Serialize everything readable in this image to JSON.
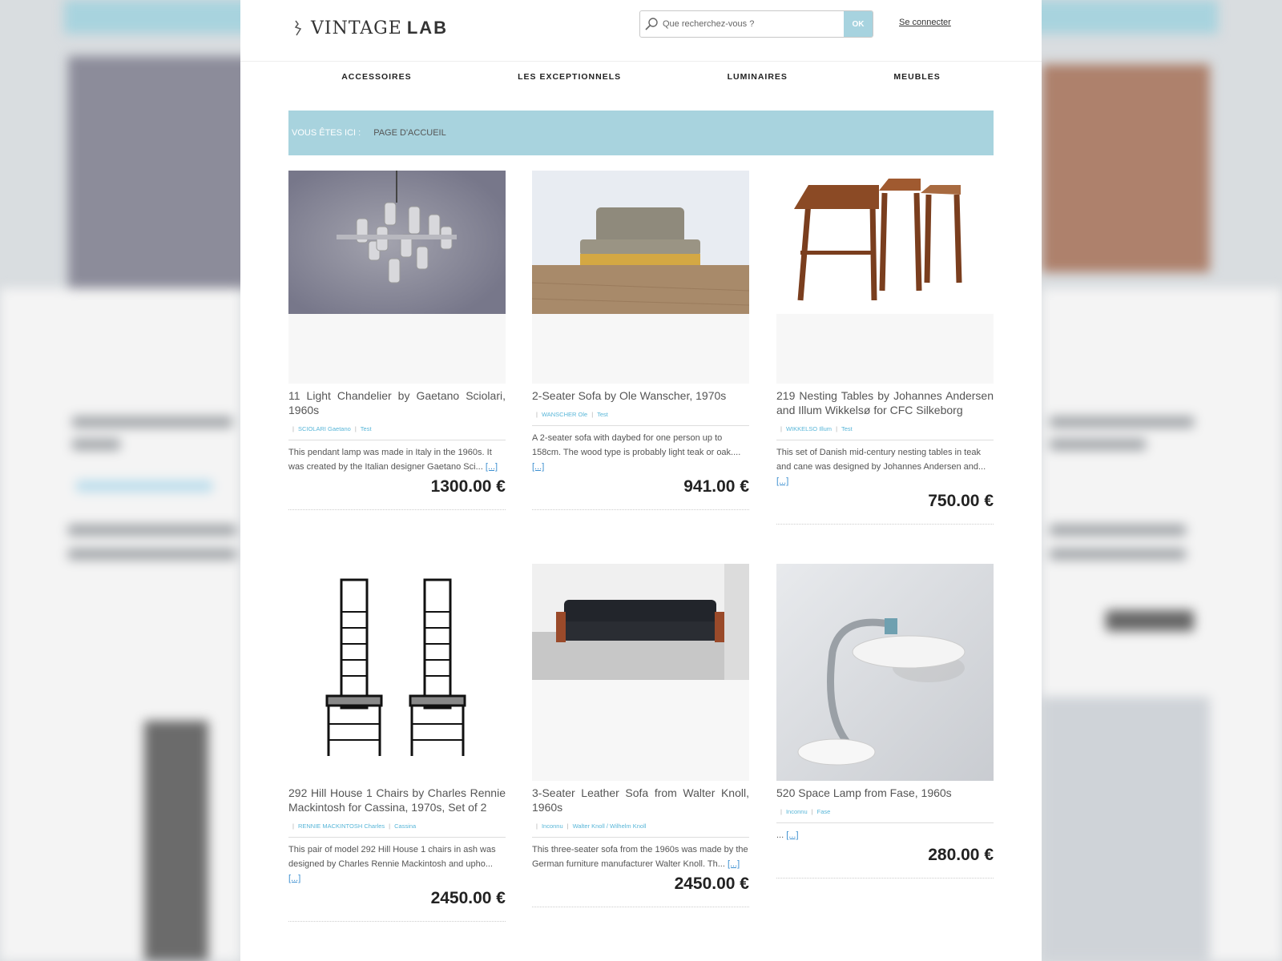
{
  "brand": {
    "name": "VINTAGE",
    "name_bold": "LAB"
  },
  "search": {
    "placeholder": "Que recherchez-vous ?",
    "button": "OK"
  },
  "account": {
    "login": "Se connecter"
  },
  "nav": [
    "ACCESSOIRES",
    "LES EXCEPTIONNELS",
    "LUMINAIRES",
    "MEUBLES"
  ],
  "breadcrumb": {
    "label": "VOUS ÊTES ICI :",
    "current": "PAGE D'ACCUEIL"
  },
  "products": [
    {
      "title": "11 Light Chandelier by Gaetano Sciolari, 1960s",
      "tags": [
        "SCIOLARI Gaetano",
        "Test"
      ],
      "description": "This pendant lamp was made in Italy in the 1960s. It was created by the Italian designer Gaetano Sci...",
      "more": "[...]",
      "price": "1300.00 €",
      "image": "chandelier"
    },
    {
      "title": "2-Seater Sofa by Ole Wanscher, 1970s",
      "tags": [
        "WANSCHER Ole",
        "Test"
      ],
      "description": "A 2-seater sofa with daybed for one person up to 158cm. The wood type is probably light teak or oak....",
      "more": "[...]",
      "price": "941.00 €",
      "image": "sofa-2-seater"
    },
    {
      "title": "219 Nesting Tables by Johannes Andersen and Illum Wikkelsø for CFC Silkeborg",
      "tags": [
        "WIKKELSO Illum",
        "Test"
      ],
      "description": "This set of Danish mid-century nesting tables in teak and cane was designed by Johannes Andersen and...",
      "more": "[...]",
      "price": "750.00 €",
      "image": "nesting-tables"
    },
    {
      "title": "292 Hill House 1 Chairs by Charles Rennie Mackintosh for Cassina, 1970s, Set of 2",
      "tags": [
        "RENNIE MACKINTOSH Charles",
        "Cassina"
      ],
      "description": "This pair of model 292 Hill House 1 chairs in ash was designed by Charles Rennie Mackintosh and upho...",
      "more": "[...]",
      "price": "2450.00 €",
      "image": "chairs"
    },
    {
      "title": "3-Seater Leather Sofa from Walter Knoll, 1960s",
      "tags": [
        "Inconnu",
        "Walter Knoll / Wilhelm Knoll"
      ],
      "description": "This three-seater sofa from the 1960s was made by the German furniture manufacturer Walter Knoll. Th...",
      "more": "[...]",
      "price": "2450.00 €",
      "image": "sofa-leather"
    },
    {
      "title": "520 Space Lamp from Fase, 1960s",
      "tags": [
        "Inconnu",
        "Fase"
      ],
      "description": "...",
      "more": "[...]",
      "price": "280.00 €",
      "image": "desk-lamp"
    }
  ],
  "colors": {
    "accent": "#a8d3de",
    "link": "#58b6d8",
    "price": "#222222"
  }
}
